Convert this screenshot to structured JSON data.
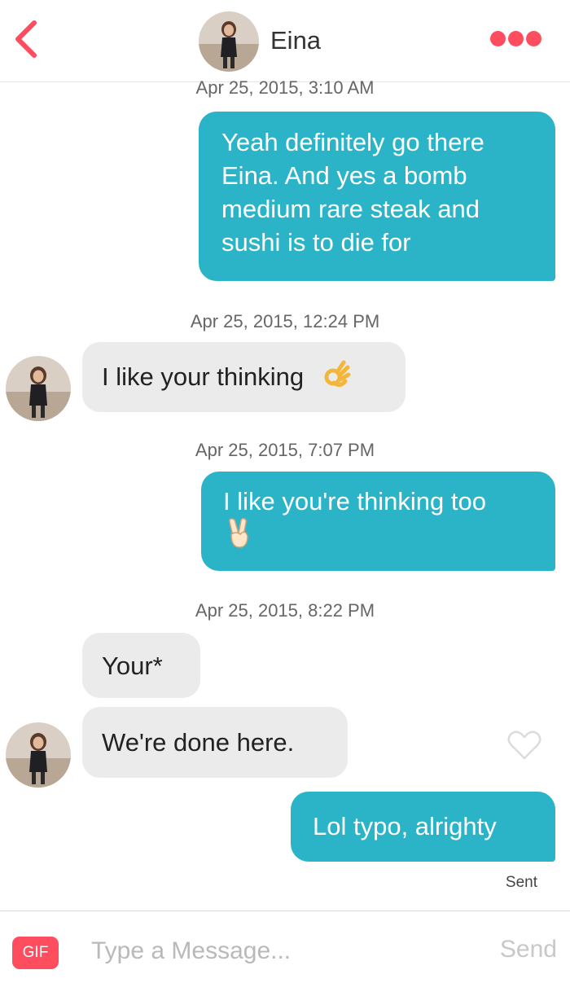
{
  "header": {
    "back_icon": "chevron-left-icon",
    "contact_name": "Eina",
    "more_icon": "three-dots-icon",
    "accent_color": "#ff4d60"
  },
  "conversation": {
    "outgoing_color": "#2bb3c8",
    "incoming_color": "#ebebeb",
    "timestamps": [
      "Apr 25, 2015, 3:10 AM",
      "Apr 25, 2015, 12:24 PM",
      "Apr 25, 2015, 7:07 PM",
      "Apr 25, 2015, 8:22 PM"
    ],
    "messages": [
      {
        "direction": "outgoing",
        "text": "Yeah definitely go there Eina. And yes a bomb medium rare steak and sushi is to die for"
      },
      {
        "direction": "incoming",
        "text": "I like your thinking",
        "emoji": "ok-hand-emoji"
      },
      {
        "direction": "outgoing",
        "text": "I like you're thinking too",
        "emoji": "victory-hand-emoji"
      },
      {
        "direction": "incoming",
        "text": "Your*"
      },
      {
        "direction": "incoming",
        "text": "We're done here."
      },
      {
        "direction": "outgoing",
        "text": "Lol typo, alrighty"
      }
    ],
    "status": "Sent",
    "like_icon": "heart-outline-icon"
  },
  "composer": {
    "gif_label": "GIF",
    "placeholder": "Type a Message...",
    "value": "",
    "send_label": "Send"
  }
}
